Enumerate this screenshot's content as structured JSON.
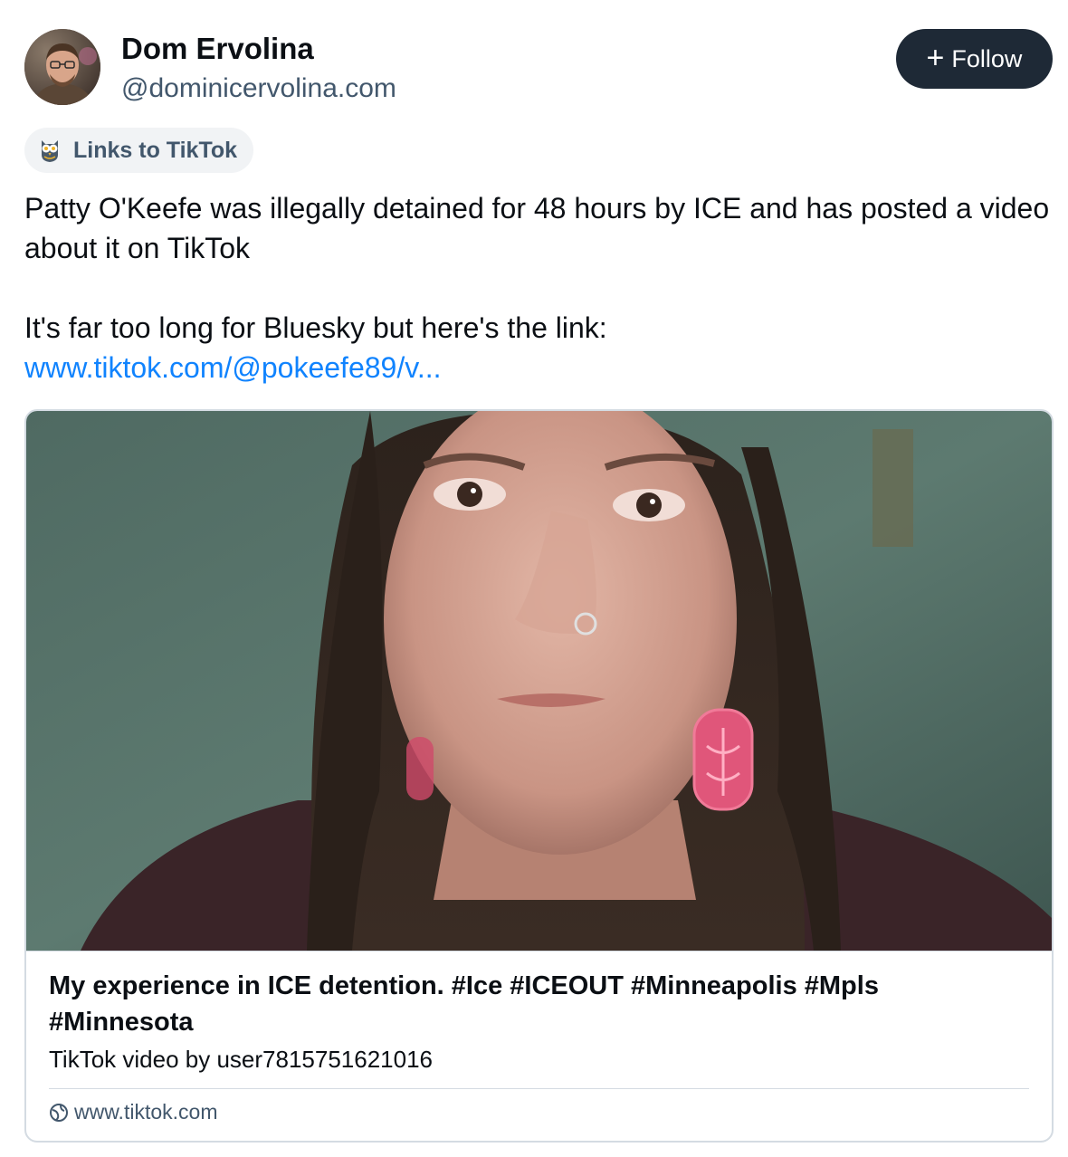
{
  "author": {
    "display_name": "Dom Ervolina",
    "handle": "@dominicervolina.com",
    "avatar_icon": "user-avatar-photo"
  },
  "follow_button": {
    "label": "Follow",
    "icon": "plus-icon"
  },
  "label_chip": {
    "text": "Links to TikTok",
    "icon": "owl-icon"
  },
  "post": {
    "paragraph1": "Patty O'Keefe was illegally detained for 48 hours by ICE and has posted a video about it on TikTok",
    "paragraph2": "It's far too long for Bluesky but here's the link:",
    "link_text": "www.tiktok.com/@pokeefe89/v..."
  },
  "link_card": {
    "title": "My experience in ICE detention. #Ice #ICEOUT #Minneapolis #Mpls #Minnesota",
    "description": "TikTok video by user7815751621016",
    "domain": "www.tiktok.com",
    "domain_icon": "globe-icon"
  },
  "colors": {
    "link": "#1083fe",
    "button_bg": "#1e2936",
    "muted_text": "#42576c",
    "border": "#d4dbe2"
  }
}
